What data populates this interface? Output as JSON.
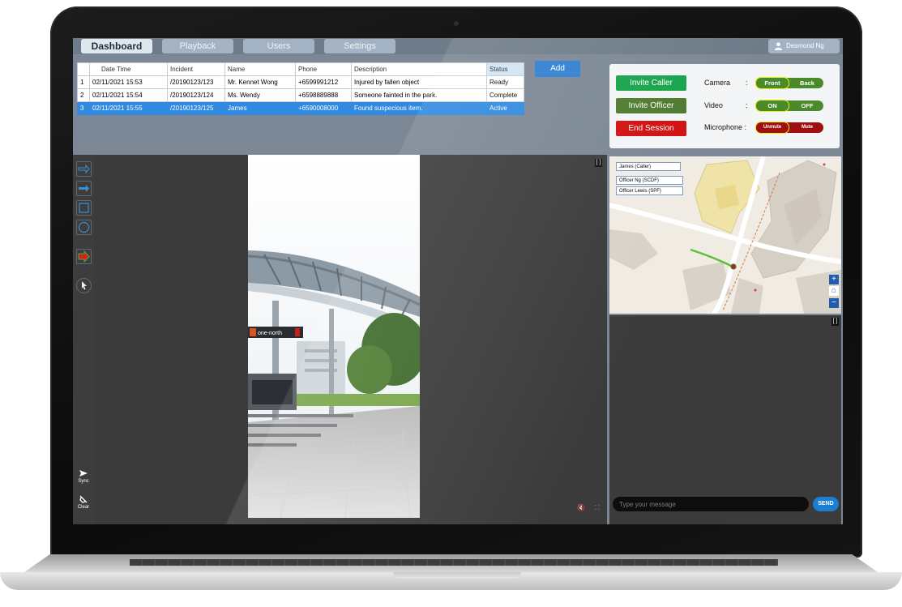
{
  "tabs": [
    "Dashboard",
    "Playback",
    "Users",
    "Settings"
  ],
  "active_tab": "Dashboard",
  "user": {
    "name": "Desmond Ng",
    "icon": "user-icon"
  },
  "table": {
    "headers": [
      "",
      "Date Time",
      "Incident",
      "Name",
      "Phone",
      "Description",
      "Status"
    ],
    "rows": [
      {
        "num": "1",
        "datetime": "02/11/2021 15:53",
        "incident": "/20190123/123",
        "name": "Mr. Kennet Wong",
        "phone": "+6599991212",
        "description": "Injured by fallen object",
        "status": "Ready"
      },
      {
        "num": "2",
        "datetime": "02/11/2021 15:54",
        "incident": "/20190123/124",
        "name": "Ms. Wendy",
        "phone": "+6598889888",
        "description": "Someone fainted in the park.",
        "status": "Complete"
      },
      {
        "num": "3",
        "datetime": "02/11/2021 15:55",
        "incident": "/20190123/125",
        "name": "James",
        "phone": "+6590008000",
        "description": "Found suspecious item.",
        "status": "Active"
      }
    ],
    "selected_row": 3
  },
  "add_label": "Add",
  "controls": {
    "invite_caller": "Invite Caller",
    "invite_officer": "Invite Officer",
    "end_session": "End Session",
    "camera": {
      "label": "Camera",
      "sep": ":",
      "on": "Front",
      "off": "Back"
    },
    "video": {
      "label": "Video",
      "sep": ":",
      "on": "ON",
      "off": "OFF"
    },
    "microphone": {
      "label": "Microphone :",
      "on": "Unmute",
      "off": "Mute"
    }
  },
  "colors": {
    "invite_caller": "#16a34a",
    "invite_officer": "#4d7a2d",
    "end_session": "#d10f0f",
    "accent": "#2e7fd1",
    "toggle_green": "#4a8a2a",
    "toggle_red": "#a01010"
  },
  "map": {
    "legend": [
      "James (Caller)",
      "Officer Ng (SCDF)",
      "Officer Lewis (SPF)"
    ],
    "zoom_in": "+",
    "home": "⌂",
    "zoom_out": "−"
  },
  "photo": {
    "sign": "one-north"
  },
  "tools": {
    "sync": "Sync",
    "clear": "Clear"
  },
  "chat": {
    "placeholder": "Type your message",
    "send": "SEND"
  },
  "bracket": "[ ]"
}
